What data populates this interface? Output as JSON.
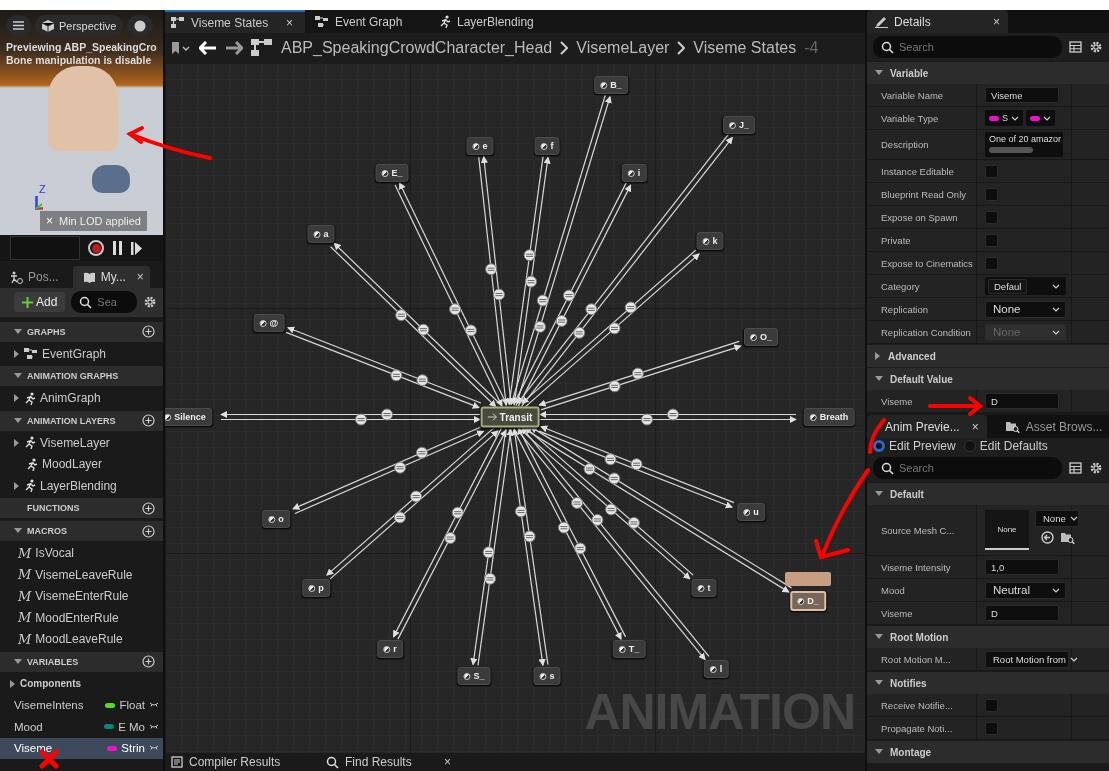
{
  "viewport": {
    "view_mode": "Perspective",
    "messages": [
      "Previewing ABP_SpeakingCro",
      "Bone manipulation is disable"
    ],
    "axis_label": "Z",
    "notice": "Min LOD applied",
    "notice_close": "×"
  },
  "left_tabs": [
    {
      "label": "Pos...",
      "selected": false
    },
    {
      "label": "My...",
      "selected": true,
      "close": "×"
    }
  ],
  "my_blueprint": {
    "add_label": "Add",
    "search_placeholder": "Sea",
    "sections": [
      {
        "title": "GRAPHS",
        "expanded": true,
        "can_add": true,
        "items": [
          {
            "kind": "graph",
            "label": "EventGraph",
            "expandable": true,
            "selected": false
          }
        ]
      },
      {
        "title": "ANIMATION GRAPHS",
        "expanded": true,
        "can_add": false,
        "items": [
          {
            "kind": "anim",
            "label": "AnimGraph",
            "expandable": true,
            "selected": false
          }
        ]
      },
      {
        "title": "ANIMATION LAYERS",
        "expanded": true,
        "can_add": true,
        "items": [
          {
            "kind": "anim",
            "label": "VisemeLayer",
            "expandable": true,
            "selected": false
          },
          {
            "kind": "anim",
            "label": "MoodLayer",
            "expandable": false,
            "selected": false
          },
          {
            "kind": "anim",
            "label": "LayerBlending",
            "expandable": true,
            "selected": false
          }
        ]
      },
      {
        "title": "FUNCTIONS",
        "can_add": true
      },
      {
        "title": "MACROS",
        "expanded": true,
        "can_add": true,
        "items": [
          {
            "kind": "macro",
            "glyph": "M",
            "label": "IsVocal",
            "selected": false
          },
          {
            "kind": "macro",
            "glyph": "M",
            "label": "VisemeLeaveRule",
            "selected": false
          },
          {
            "kind": "macro",
            "glyph": "M",
            "label": "VisemeEnterRule",
            "selected": false
          },
          {
            "kind": "macro",
            "glyph": "M",
            "label": "MoodEnterRule",
            "selected": false
          },
          {
            "kind": "macro",
            "glyph": "M",
            "label": "MoodLeaveRule",
            "selected": false
          }
        ]
      },
      {
        "title": "VARIABLES",
        "expanded": true,
        "can_add": true,
        "items": [
          {
            "kind": "category",
            "label": "Components",
            "expandable": true,
            "selected": false
          },
          {
            "kind": "variable",
            "label": "VisemeIntens",
            "type": "Float",
            "color": "#55dd22",
            "selected": false
          },
          {
            "kind": "variable",
            "label": "Mood",
            "type": "E Mo",
            "color": "#008878",
            "selected": false
          },
          {
            "kind": "variable",
            "label": "Viseme",
            "type": "Strin",
            "color": "#ee11cc",
            "selected": true
          }
        ]
      }
    ]
  },
  "doc_tabs": [
    {
      "label": "Viseme States",
      "selected": true,
      "close": "×"
    },
    {
      "label": "Event Graph",
      "selected": false
    },
    {
      "label": "LayerBlending",
      "selected": false
    }
  ],
  "breadcrumb": {
    "items": [
      "ABP_SpeakingCrowdCharacter_Head",
      "VisemeLayer",
      "Viseme States"
    ],
    "zoom": "-4"
  },
  "state_machine": {
    "entry": "Transit",
    "type_label": "ANIMATION",
    "states": [
      {
        "name": "B_",
        "active": false
      },
      {
        "name": "J_",
        "active": false
      },
      {
        "name": "e",
        "active": false
      },
      {
        "name": "f",
        "active": false
      },
      {
        "name": "E_",
        "active": false
      },
      {
        "name": "i",
        "active": false
      },
      {
        "name": "a",
        "active": false
      },
      {
        "name": "k",
        "active": false
      },
      {
        "name": "@",
        "active": false
      },
      {
        "name": "O_",
        "active": false
      },
      {
        "name": "Silence",
        "active": false
      },
      {
        "name": "Breath",
        "active": false
      },
      {
        "name": "o",
        "active": false
      },
      {
        "name": "u",
        "active": false
      },
      {
        "name": "p",
        "active": false
      },
      {
        "name": "t",
        "active": false
      },
      {
        "name": "D_",
        "active": true
      },
      {
        "name": "r",
        "active": false
      },
      {
        "name": "T_",
        "active": false
      },
      {
        "name": "S_",
        "active": false
      },
      {
        "name": "s",
        "active": false
      },
      {
        "name": "l",
        "active": false
      }
    ]
  },
  "bottom_tabs": [
    {
      "label": "Compiler Results"
    },
    {
      "label": "Find Results",
      "close": "×"
    }
  ],
  "details": {
    "title": "Details",
    "close": "×",
    "search_placeholder": "Search",
    "sections": [
      {
        "title": "Variable",
        "expanded": true,
        "rows": [
          {
            "kind": "text",
            "label": "Variable Name",
            "value": "Viseme"
          },
          {
            "kind": "type",
            "label": "Variable Type",
            "value": "S",
            "color": "#ee11cc"
          },
          {
            "kind": "textarea",
            "label": "Description",
            "value": "One of 20 amazor"
          },
          {
            "kind": "checkbox",
            "label": "Instance Editable",
            "checked": false
          },
          {
            "kind": "checkbox",
            "label": "Blueprint Read Only",
            "checked": false
          },
          {
            "kind": "checkbox",
            "label": "Expose on Spawn",
            "checked": false
          },
          {
            "kind": "checkbox",
            "label": "Private",
            "checked": false
          },
          {
            "kind": "checkbox",
            "label": "Expose to Cinematics",
            "checked": false
          },
          {
            "kind": "combo",
            "label": "Category",
            "value": "Defaul"
          },
          {
            "kind": "dropdown",
            "label": "Replication",
            "value": "None",
            "disabled": false
          },
          {
            "kind": "dropdown",
            "label": "Replication Condition",
            "value": "None",
            "disabled": true
          }
        ]
      },
      {
        "title": "Advanced",
        "expanded": false
      },
      {
        "title": "Default Value",
        "expanded": true,
        "rows": [
          {
            "kind": "text",
            "label": "Viseme",
            "value": "D"
          }
        ]
      }
    ]
  },
  "anim_preview": {
    "tabs": [
      {
        "label": "Anim Previe...",
        "selected": true,
        "close": "×"
      },
      {
        "label": "Asset Brows...",
        "selected": false
      }
    ],
    "modes": [
      {
        "label": "Edit Preview",
        "selected": true
      },
      {
        "label": "Edit Defaults",
        "selected": false
      }
    ],
    "search_placeholder": "Search",
    "sections": [
      {
        "title": "Default",
        "expanded": true,
        "rows": [
          {
            "kind": "asset",
            "label": "Source Mesh C...",
            "thumbnail": "None",
            "value": "None"
          },
          {
            "kind": "text",
            "label": "Viseme Intensity",
            "value": "1,0"
          },
          {
            "kind": "dropdown",
            "label": "Mood",
            "value": "Neutral",
            "disabled": false
          },
          {
            "kind": "text",
            "label": "Viseme",
            "value": "D"
          }
        ]
      },
      {
        "title": "Root Motion",
        "expanded": true,
        "rows": [
          {
            "kind": "dropdown",
            "label": "Root Motion M...",
            "value": "Root Motion from",
            "disabled": false
          }
        ]
      },
      {
        "title": "Notifies",
        "expanded": true,
        "rows": [
          {
            "kind": "checkbox",
            "label": "Receive Notifie...",
            "checked": false
          },
          {
            "kind": "checkbox",
            "label": "Propagate Noti...",
            "checked": false
          }
        ]
      },
      {
        "title": "Montage",
        "expanded": true
      }
    ]
  }
}
